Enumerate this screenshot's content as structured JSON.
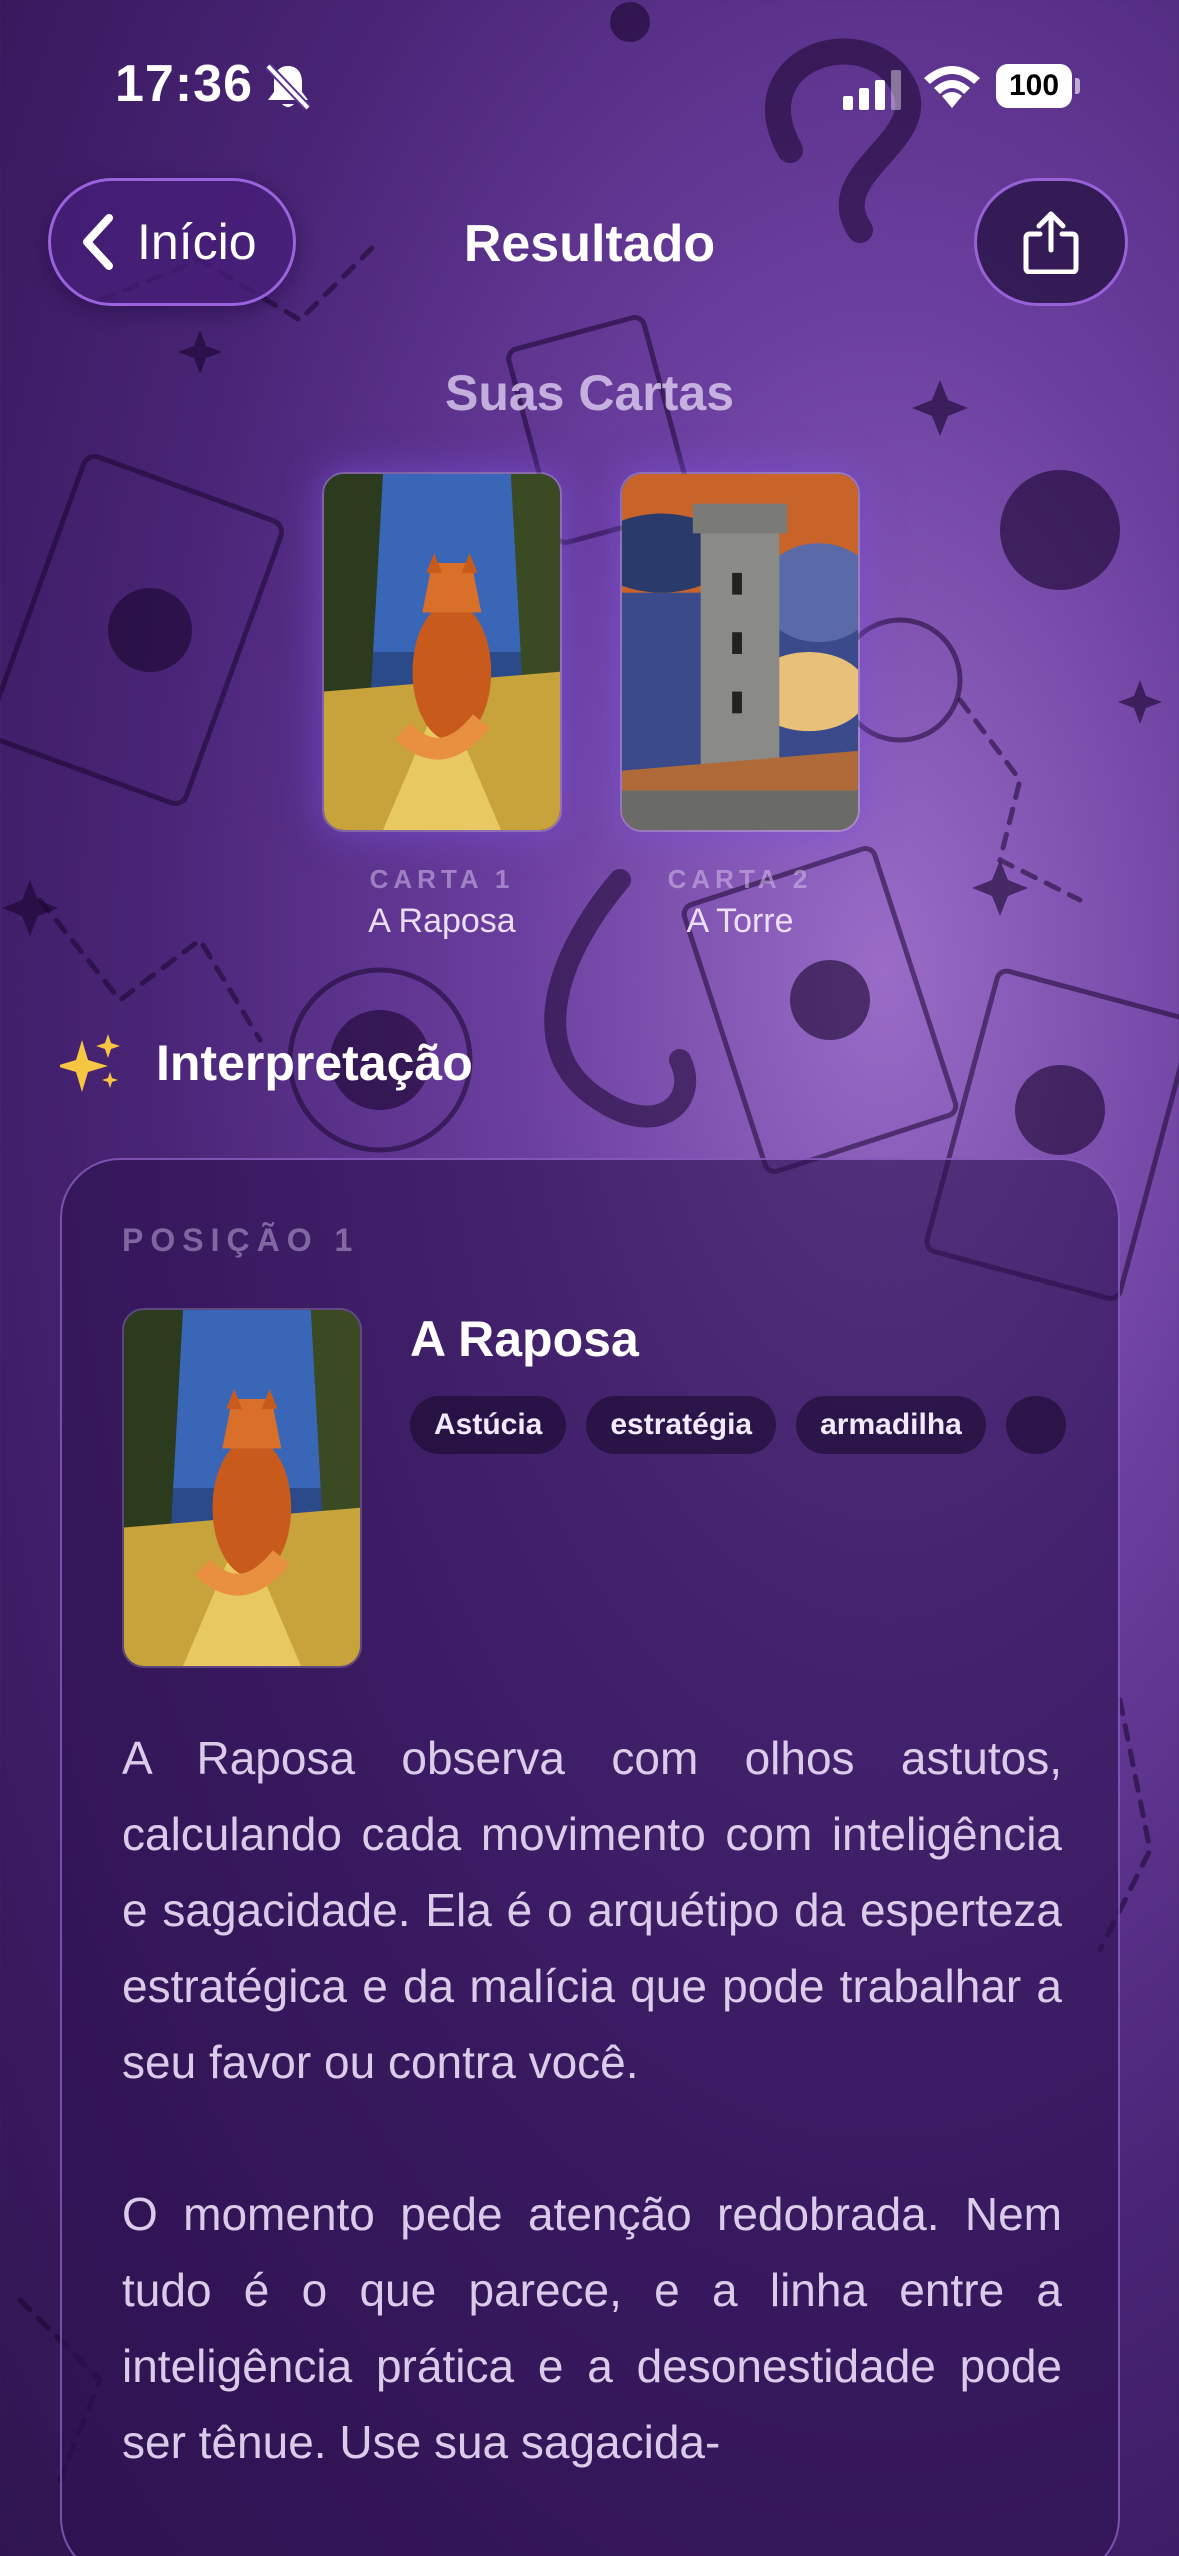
{
  "status_bar": {
    "time": "17:36",
    "battery": "100"
  },
  "nav": {
    "back_label": "Início",
    "title": "Resultado"
  },
  "cards_section": {
    "title": "Suas Cartas",
    "cards": [
      {
        "label": "CARTA 1",
        "name": "A Raposa"
      },
      {
        "label": "CARTA 2",
        "name": "A Torre"
      }
    ]
  },
  "interpretation": {
    "title": "Interpretação",
    "position_label": "POSIÇÃO 1",
    "card_title": "A Raposa",
    "keywords": [
      "Astúcia",
      "estratégia",
      "armadilha",
      ""
    ],
    "paragraphs": [
      "A Raposa observa com olhos astutos, calculando cada movimento com inteligência e sagacidade. Ela é o arquétipo da esperteza estratégica e da malícia que pode trabalhar a seu favor ou contra você.",
      "O momento pede atenção redobrada. Nem tudo é o que parece, e a linha entre a inteligência prática e a desonestidade pode ser tênue. Use sua sagacida-"
    ]
  },
  "colors": {
    "accent": "#a56ef0",
    "panel": "#2d1250"
  }
}
